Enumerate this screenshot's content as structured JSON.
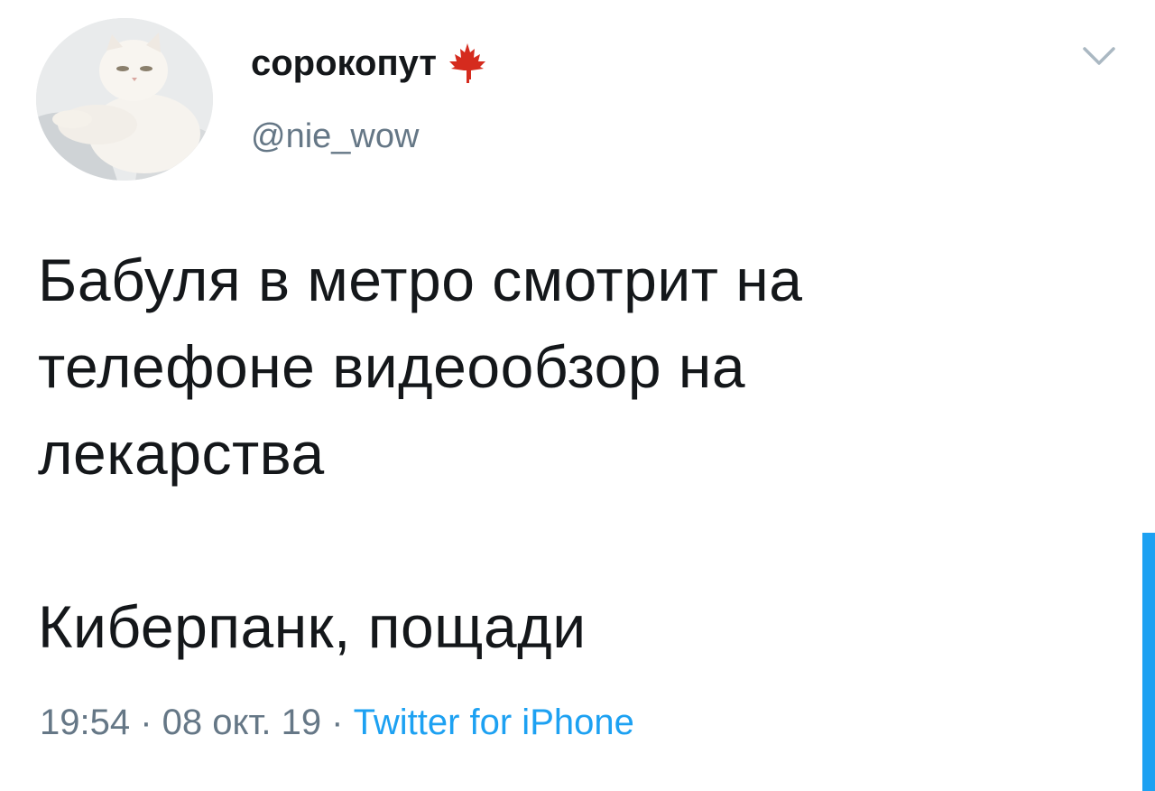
{
  "tweet": {
    "author": {
      "display_name": "сорокопут",
      "handle": "@nie_wow",
      "avatar_icon": "cat-avatar",
      "name_badge_icon": "maple-leaf-icon"
    },
    "text_lines": [
      "Бабуля в метро смотрит на",
      "телефоне видеообзор на",
      "лекарства"
    ],
    "text_line_final": "Киберпанк, пощади",
    "time": "19:54",
    "separator": " · ",
    "date": "08 окт. 19",
    "source": "Twitter for iPhone",
    "menu_icon": "chevron-down-icon"
  },
  "colors": {
    "text": "#14171a",
    "secondary": "#657786",
    "accent": "#1da1f2",
    "flag_red": "#d52b1e"
  }
}
